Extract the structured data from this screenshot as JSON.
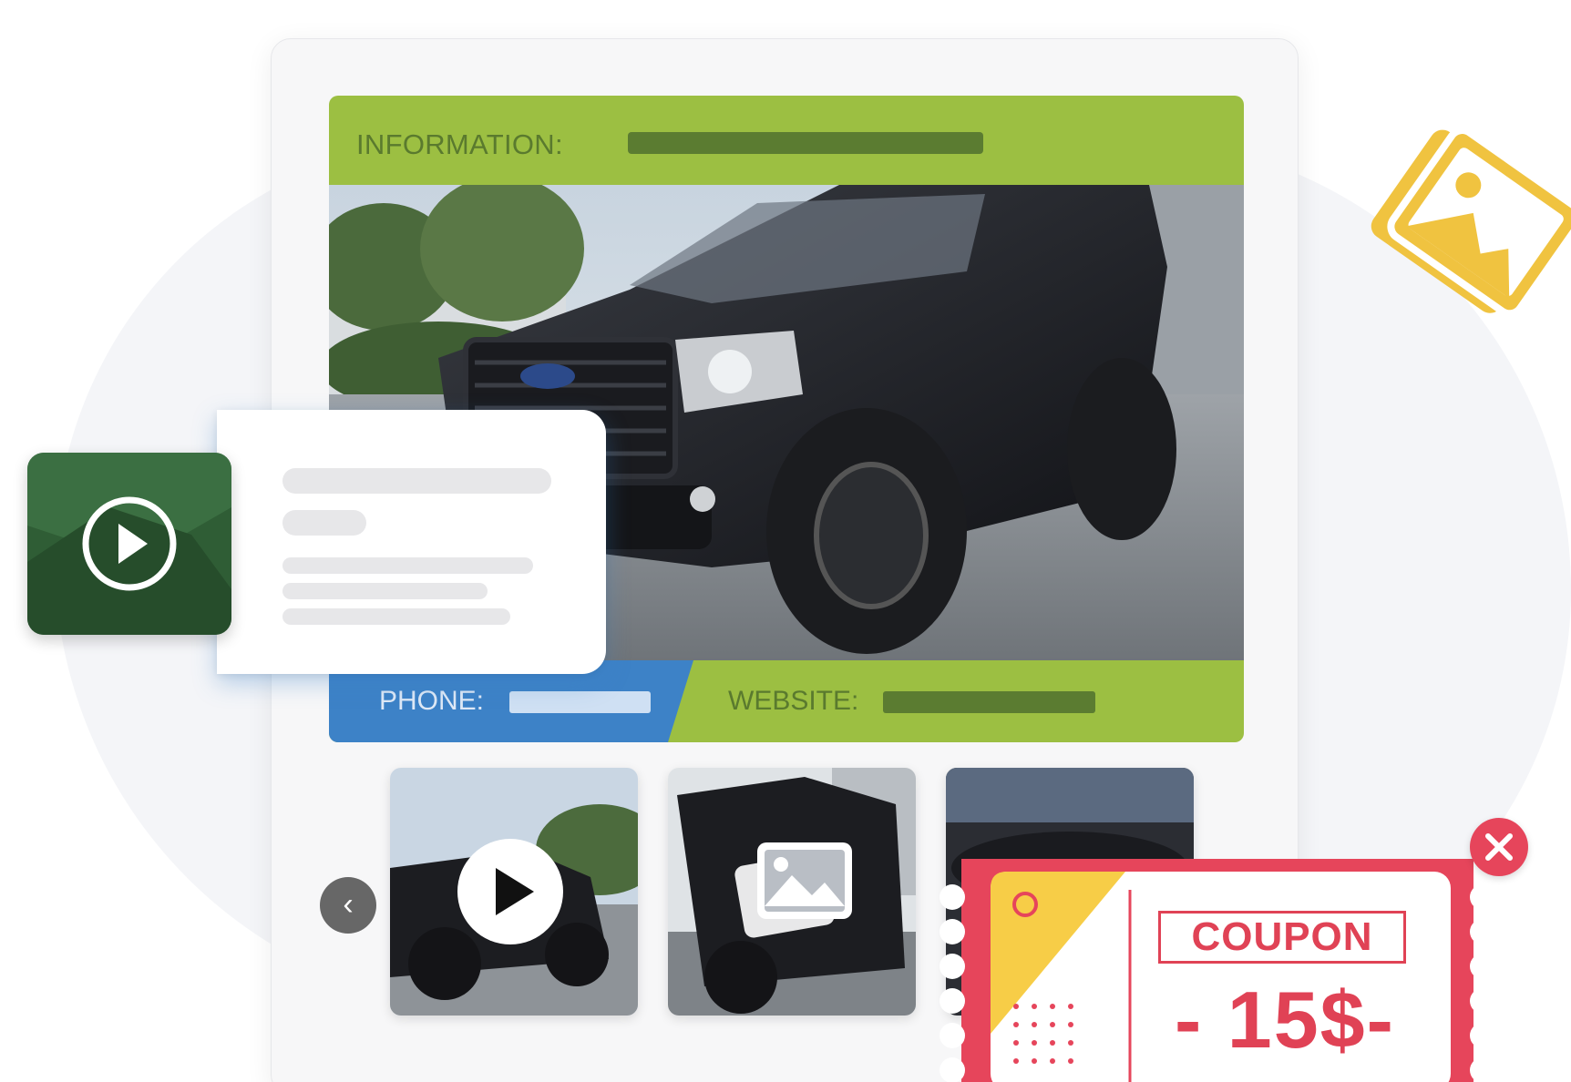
{
  "info_bar": {
    "label": "INFORMATION:"
  },
  "contact_bar": {
    "phone_label": "PHONE:",
    "website_label": "WEBSITE:"
  },
  "thumbnails": [
    {
      "kind": "video"
    },
    {
      "kind": "image"
    },
    {
      "kind": "engine"
    }
  ],
  "carousel": {
    "prev_glyph": "‹"
  },
  "coupon": {
    "title": "COUPON",
    "value": "- 15$-"
  },
  "colors": {
    "green": "#9cbf42",
    "dark_green": "#5b7c31",
    "blue": "#3d82c7",
    "coupon_red": "#e6455b",
    "coupon_yellow": "#f7cd47",
    "photo_icon_yellow": "#f0c340"
  },
  "icons": [
    "play-icon",
    "image-icon",
    "chevron-left-icon",
    "close-icon",
    "photos-icon"
  ]
}
